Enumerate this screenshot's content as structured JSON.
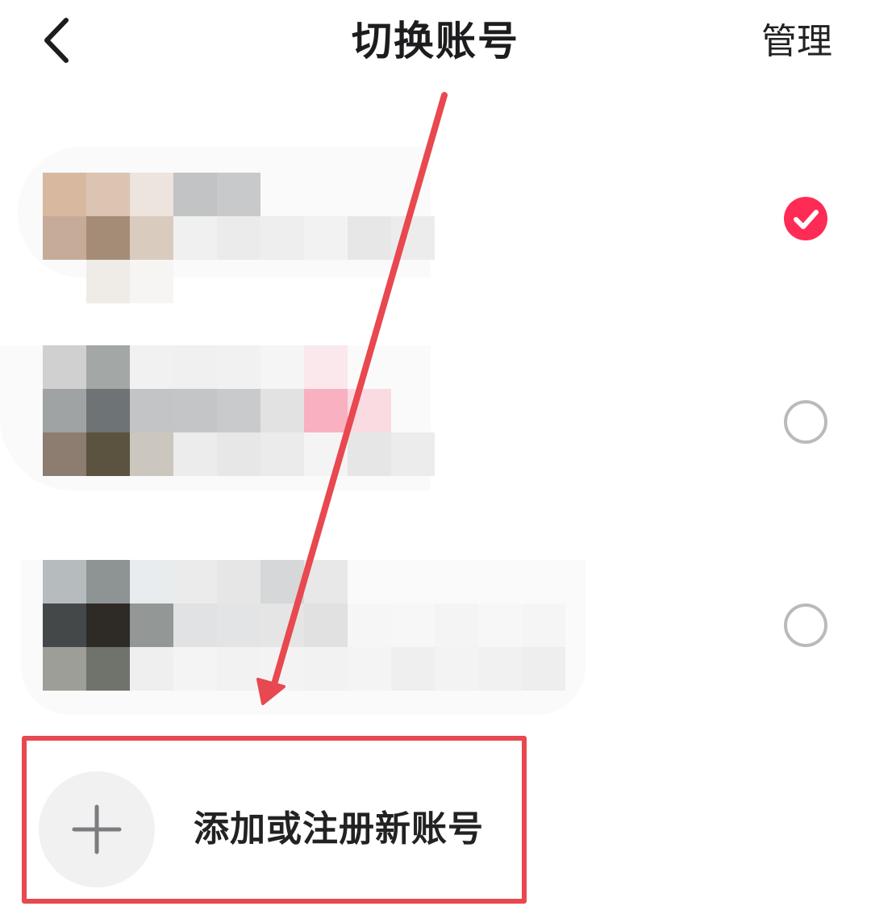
{
  "header": {
    "back_icon": "chevron-left-icon",
    "title": "切换账号",
    "manage_label": "管理"
  },
  "accounts": [
    {
      "id": "account-1",
      "selected": true,
      "pixelated": true
    },
    {
      "id": "account-2",
      "selected": false,
      "pixelated": true
    },
    {
      "id": "account-3",
      "selected": false,
      "pixelated": true
    }
  ],
  "add_account": {
    "icon": "plus-icon",
    "label": "添加或注册新账号"
  },
  "colors": {
    "accent": "#fe2c55",
    "annotation": "#e8484f",
    "radio_border": "#b9babd"
  }
}
